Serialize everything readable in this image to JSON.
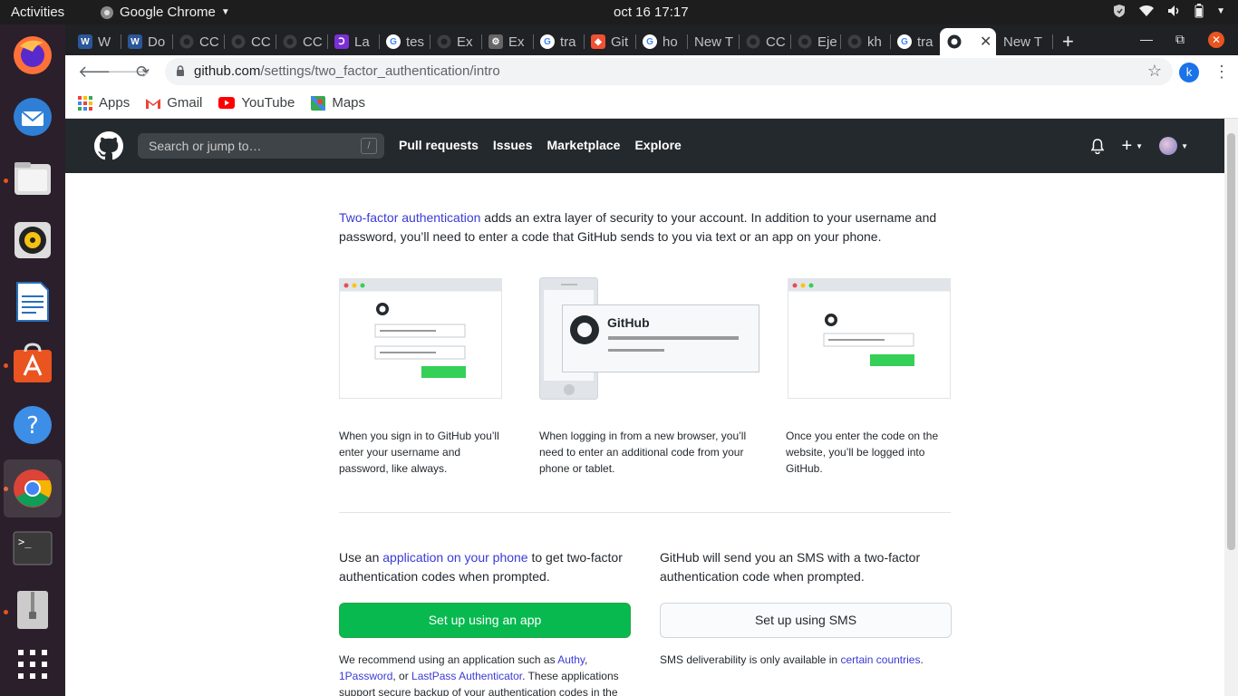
{
  "system_bar": {
    "activities": "Activities",
    "app_name": "Google Chrome",
    "clock": "oct 16  17:17"
  },
  "browser": {
    "tabs": [
      {
        "label": "W",
        "icon": "word-icon"
      },
      {
        "label": "Do",
        "icon": "word-icon"
      },
      {
        "label": "CC",
        "icon": "github-icon"
      },
      {
        "label": "CC",
        "icon": "github-icon"
      },
      {
        "label": "CC",
        "icon": "github-icon"
      },
      {
        "label": "La",
        "icon": "app-icon"
      },
      {
        "label": "tes",
        "icon": "google-icon"
      },
      {
        "label": "Ex",
        "icon": "github-icon"
      },
      {
        "label": "Ex",
        "icon": "gear-icon"
      },
      {
        "label": "tra",
        "icon": "google-icon"
      },
      {
        "label": "Git",
        "icon": "git-icon"
      },
      {
        "label": "ho",
        "icon": "google-icon"
      },
      {
        "label": "New T",
        "icon": "none"
      },
      {
        "label": "CC",
        "icon": "github-icon"
      },
      {
        "label": "Eje",
        "icon": "github-icon"
      },
      {
        "label": "kh",
        "icon": "github-icon"
      },
      {
        "label": "tra",
        "icon": "google-icon"
      },
      {
        "label": "",
        "icon": "github-icon",
        "active": true
      },
      {
        "label": "New T",
        "icon": "none"
      }
    ],
    "url_host": "github.com",
    "url_path": "/settings/two_factor_authentication/intro",
    "profile_initial": "k",
    "bookmarks": [
      {
        "label": "Apps",
        "icon": "apps-grid-icon"
      },
      {
        "label": "Gmail",
        "icon": "gmail-icon"
      },
      {
        "label": "YouTube",
        "icon": "youtube-icon"
      },
      {
        "label": "Maps",
        "icon": "maps-icon"
      }
    ]
  },
  "github": {
    "search_placeholder": "Search or jump to…",
    "search_shortcut": "/",
    "nav": [
      "Pull requests",
      "Issues",
      "Marketplace",
      "Explore"
    ],
    "intro_link": "Two-factor authentication",
    "intro_text": " adds an extra layer of security to your account. In addition to your username and password, you’ll need to enter a code that GitHub sends to you via text or an app on your phone.",
    "phone_card_title": "GitHub",
    "captions": [
      "When you sign in to GitHub you’ll enter your username and password, like always.",
      "When logging in from a new browser, you’ll need to enter an additional code from your phone or tablet.",
      "Once you enter the code on the website, you’ll be logged into GitHub."
    ],
    "app_col": {
      "prefix": "Use an ",
      "link": "application on your phone",
      "suffix": " to get two-factor authentication codes when prompted.",
      "button": "Set up using an app",
      "note_prefix": "We recommend using an application such as ",
      "note_link1": "Authy",
      "note_mid1": ", ",
      "note_link2": "1Password",
      "note_mid2": ", or ",
      "note_link3": "LastPass Authenticator",
      "note_suffix": ". These applications support secure backup of your authentication codes in the"
    },
    "sms_col": {
      "text": "GitHub will send you an SMS with a two-factor authentication code when prompted.",
      "button": "Set up using SMS",
      "note_prefix": "SMS deliverability is only available in ",
      "note_link": "certain countries",
      "note_suffix": "."
    }
  },
  "colors": {
    "github_header": "#24292e",
    "primary_button": "#07b94f",
    "link": "#3a3ad6",
    "chrome_tabstrip": "#202124",
    "dock": "#2b1f2b"
  }
}
